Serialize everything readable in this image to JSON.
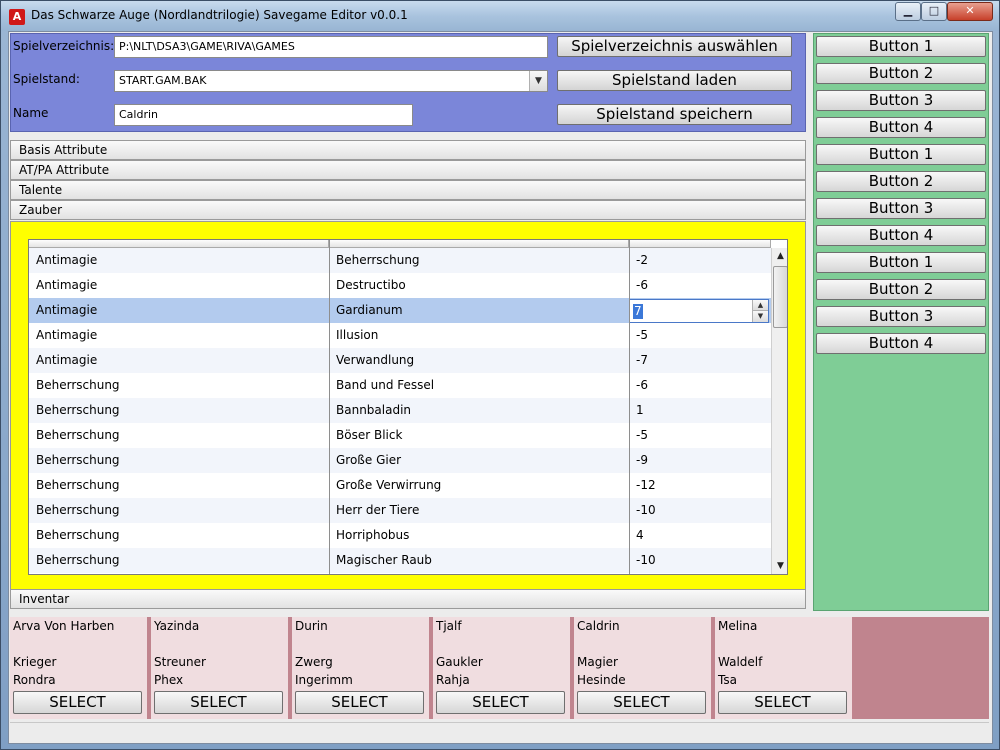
{
  "window": {
    "title": "Das Schwarze Auge (Nordlandtrilogie) Savegame Editor v0.0.1",
    "icon_glyph": "A",
    "minimize_glyph": "▁",
    "maximize_glyph": "□",
    "close_glyph": "✕"
  },
  "config": {
    "dir_label": "Spielverzeichnis:",
    "dir_value": "P:\\NLT\\DSA3\\GAME\\RIVA\\GAMES",
    "dir_button": "Spielverzeichnis auswählen",
    "save_label": "Spielstand:",
    "save_value": "START.GAM.BAK",
    "save_arrow": "▼",
    "load_button": "Spielstand laden",
    "name_label": "Name",
    "name_value": "Caldrin",
    "store_button": "Spielstand speichern"
  },
  "accordion": {
    "basis": "Basis Attribute",
    "atpa": "AT/PA Attribute",
    "talente": "Talente",
    "zauber": "Zauber",
    "inventar": "Inventar"
  },
  "spells": {
    "rows": [
      {
        "category": "Antimagie",
        "spell": "Beherrschung",
        "value": "-2"
      },
      {
        "category": "Antimagie",
        "spell": "Destructibo",
        "value": "-6"
      },
      {
        "category": "Antimagie",
        "spell": "Gardianum",
        "value": "7"
      },
      {
        "category": "Antimagie",
        "spell": "Illusion",
        "value": "-5"
      },
      {
        "category": "Antimagie",
        "spell": "Verwandlung",
        "value": "-7"
      },
      {
        "category": "Beherrschung",
        "spell": "Band und Fessel",
        "value": "-6"
      },
      {
        "category": "Beherrschung",
        "spell": "Bannbaladin",
        "value": "1"
      },
      {
        "category": "Beherrschung",
        "spell": "Böser Blick",
        "value": "-5"
      },
      {
        "category": "Beherrschung",
        "spell": "Große Gier",
        "value": "-9"
      },
      {
        "category": "Beherrschung",
        "spell": "Große Verwirrung",
        "value": "-12"
      },
      {
        "category": "Beherrschung",
        "spell": "Herr der Tiere",
        "value": "-10"
      },
      {
        "category": "Beherrschung",
        "spell": "Horriphobus",
        "value": "4"
      },
      {
        "category": "Beherrschung",
        "spell": "Magischer Raub",
        "value": "-10"
      }
    ],
    "spin_up": "▲",
    "spin_down": "▼",
    "scroll_up": "▲",
    "scroll_down": "▼"
  },
  "side_buttons": [
    "Button 1",
    "Button 2",
    "Button 3",
    "Button 4",
    "Button 1",
    "Button 2",
    "Button 3",
    "Button 4",
    "Button 1",
    "Button 2",
    "Button 3",
    "Button 4"
  ],
  "characters": [
    {
      "name": "Arva Von Harben",
      "class": "Krieger",
      "god": "Rondra",
      "button": "SELECT"
    },
    {
      "name": "Yazinda",
      "class": "Streuner",
      "god": "Phex",
      "button": "SELECT"
    },
    {
      "name": "Durin",
      "class": "Zwerg",
      "god": "Ingerimm",
      "button": "SELECT"
    },
    {
      "name": "Tjalf",
      "class": "Gaukler",
      "god": "Rahja",
      "button": "SELECT"
    },
    {
      "name": "Caldrin",
      "class": "Magier",
      "god": "Hesinde",
      "button": "SELECT"
    },
    {
      "name": "Melina",
      "class": "Waldelf",
      "god": "Tsa",
      "button": "SELECT"
    }
  ]
}
